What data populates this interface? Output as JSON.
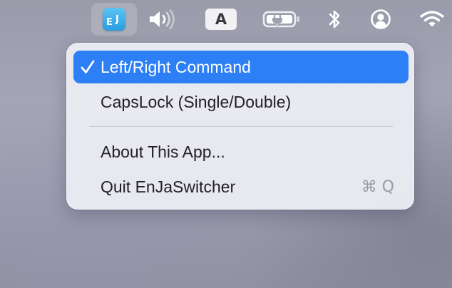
{
  "menubar": {
    "app_icon": {
      "icon": "enja-app-icon",
      "letter_1": "E",
      "letter_2": "J"
    },
    "volume": {
      "icon": "speaker-volume-icon"
    },
    "input_source": {
      "icon": "input-source-icon",
      "label": "A"
    },
    "battery": {
      "icon": "battery-charging-icon"
    },
    "bluetooth": {
      "icon": "bluetooth-icon"
    },
    "user": {
      "icon": "user-account-icon"
    },
    "wifi": {
      "icon": "wifi-icon"
    }
  },
  "menu": {
    "items": [
      {
        "label": "Left/Right Command",
        "checked": true,
        "selected": true
      },
      {
        "label": "CapsLock (Single/Double)",
        "checked": false,
        "selected": false
      },
      {
        "label": "About This App...",
        "checked": false,
        "selected": false
      },
      {
        "label": "Quit EnJaSwitcher",
        "shortcut": "⌘ Q",
        "checked": false,
        "selected": false
      }
    ]
  },
  "colors": {
    "selection": "#2d7ff5",
    "menu_background": "#ebebf3",
    "shortcut_text": "#9a9aa3"
  }
}
